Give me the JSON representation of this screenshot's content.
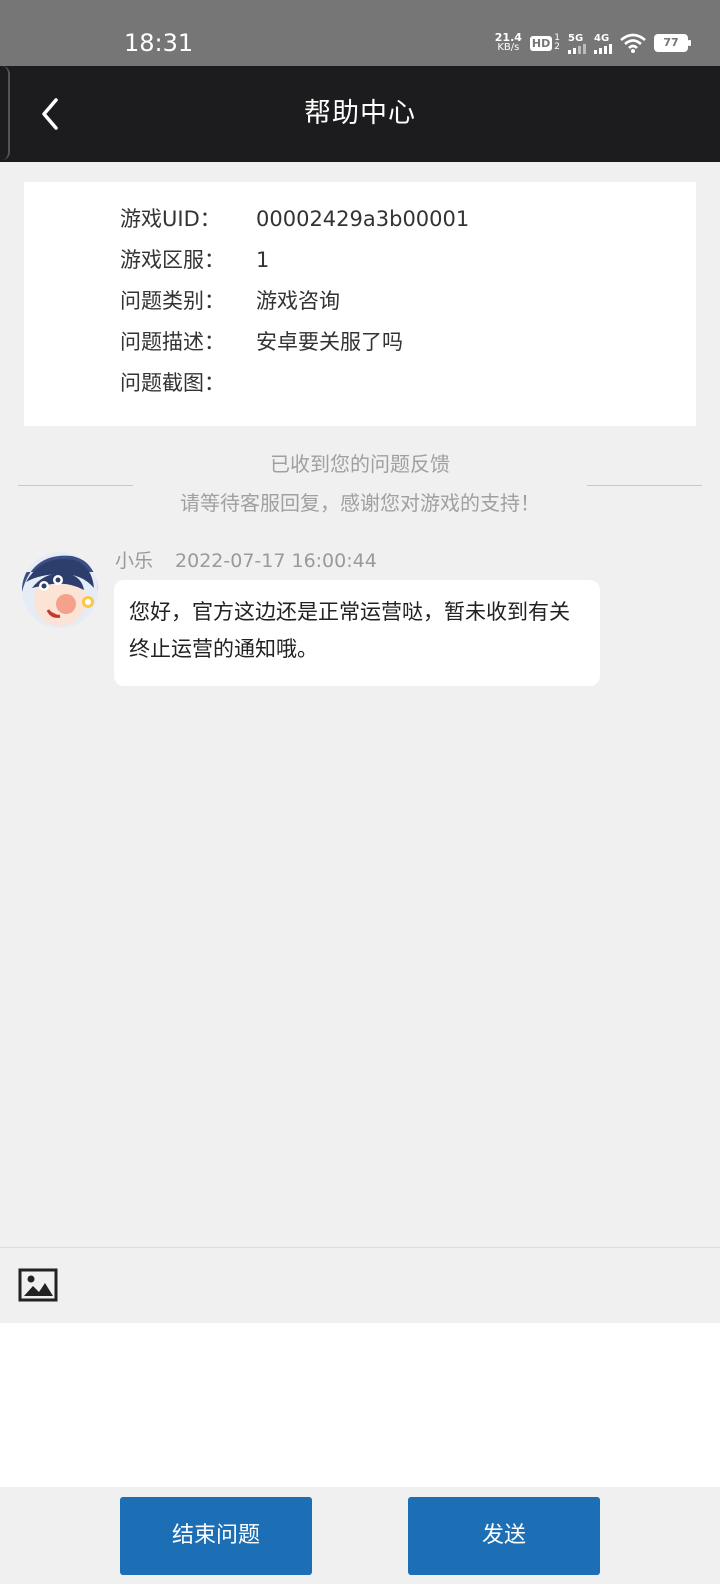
{
  "status_bar": {
    "time": "18:31",
    "net_speed_value": "21.4",
    "net_speed_unit": "KB/s",
    "hd_label": "HD",
    "sim_slots": [
      "1",
      "2"
    ],
    "sim1_network": "5G",
    "sim2_network": "4G",
    "battery": "77"
  },
  "header": {
    "title": "帮助中心",
    "back_icon": "chevron-left-icon"
  },
  "ticket": {
    "rows": [
      {
        "label": "游戏UID：",
        "value": "00002429a3b00001"
      },
      {
        "label": "游戏区服：",
        "value": "1"
      },
      {
        "label": "问题类别：",
        "value": "游戏咨询"
      },
      {
        "label": "问题描述：",
        "value": "安卓要关服了吗"
      },
      {
        "label": "问题截图：",
        "value": ""
      }
    ]
  },
  "notice": {
    "line1": "已收到您的问题反馈",
    "line2": "请等待客服回复，感谢您对游戏的支持！"
  },
  "message": {
    "sender": "小乐",
    "timestamp": "2022-07-17 16:00:44",
    "text": "您好，官方这边还是正常运营哒，暂未收到有关终止运营的通知哦。"
  },
  "composer": {
    "image_icon": "image-icon",
    "input_value": ""
  },
  "actions": {
    "end_label": "结束问题",
    "send_label": "发送"
  },
  "colors": {
    "header_bg": "#1c1c1e",
    "button_bg": "#1c6fb5",
    "page_bg": "#f0f0f0"
  }
}
